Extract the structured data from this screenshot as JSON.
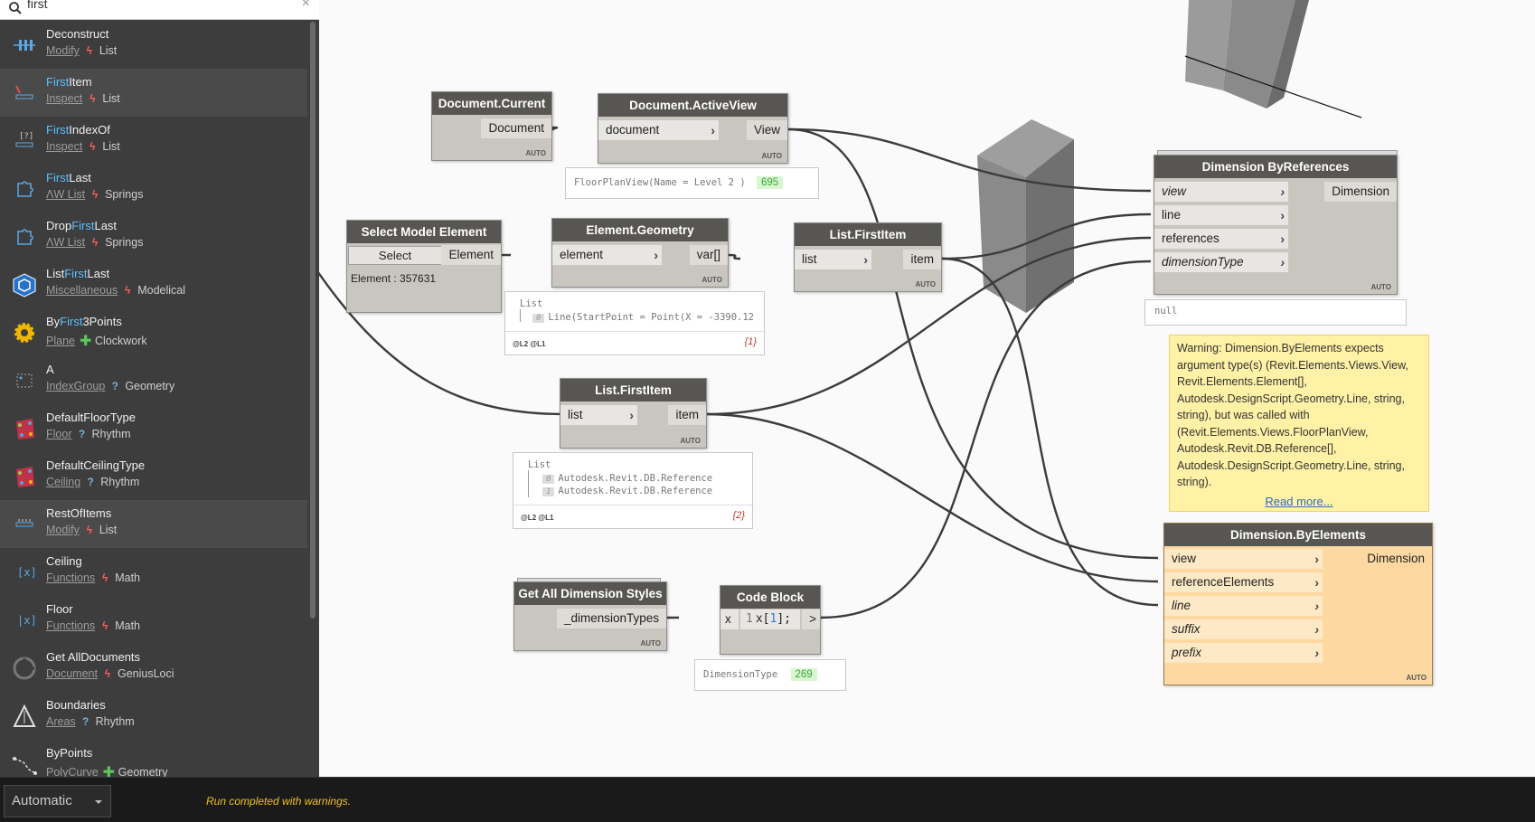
{
  "search": {
    "query": "first",
    "clear_glyph": "×"
  },
  "library": [
    {
      "pre": "",
      "match": "",
      "post": "Deconstruct",
      "category": "Modify",
      "type": "action",
      "type_glyph": "ϟ",
      "package": "List",
      "icon": "deconstruct-icon",
      "hl": false
    },
    {
      "pre": "",
      "match": "First",
      "post": "Item",
      "category": "Inspect",
      "type": "action",
      "type_glyph": "ϟ",
      "package": "List",
      "icon": "first-item-icon",
      "hl": true
    },
    {
      "pre": "",
      "match": "First",
      "post": "IndexOf",
      "category": "Inspect",
      "type": "action",
      "type_glyph": "ϟ",
      "package": "List",
      "icon": "first-index-of-icon",
      "hl": false
    },
    {
      "pre": "",
      "match": "First",
      "post": "Last",
      "category": "ΛW List",
      "type": "action",
      "type_glyph": "ϟ",
      "package": "Springs",
      "icon": "puzzle-icon",
      "hl": false
    },
    {
      "pre": "Drop",
      "match": "First",
      "post": "Last",
      "category": "ΛW List",
      "type": "action",
      "type_glyph": "ϟ",
      "package": "Springs",
      "icon": "puzzle-icon",
      "hl": false
    },
    {
      "pre": "List",
      "match": "First",
      "post": "Last",
      "category": "Miscellaneous",
      "type": "action",
      "type_glyph": "ϟ",
      "package": "Modelical",
      "icon": "cube-icon",
      "hl": false
    },
    {
      "pre": "By",
      "match": "First",
      "post": "3Points",
      "category": "Plane",
      "type": "create",
      "type_glyph": "✚",
      "package": "Clockwork",
      "icon": "gear-icon",
      "hl": false
    },
    {
      "pre": "",
      "match": "",
      "post": "A",
      "category": "IndexGroup",
      "type": "query",
      "type_glyph": "?",
      "package": "Geometry",
      "icon": "index-group-icon",
      "hl": false
    },
    {
      "pre": "",
      "match": "",
      "post": "DefaultFloorType",
      "category": "Floor",
      "type": "query",
      "type_glyph": "?",
      "package": "Rhythm",
      "icon": "rhythm-icon",
      "hl": false
    },
    {
      "pre": "",
      "match": "",
      "post": "DefaultCeilingType",
      "category": "Ceiling",
      "type": "query",
      "type_glyph": "?",
      "package": "Rhythm",
      "icon": "rhythm-icon",
      "hl": false
    },
    {
      "pre": "",
      "match": "",
      "post": "RestOfItems",
      "category": "Modify",
      "type": "action",
      "type_glyph": "ϟ",
      "package": "List",
      "icon": "rest-of-items-icon",
      "hl": true
    },
    {
      "pre": "",
      "match": "",
      "post": "Ceiling",
      "category": "Functions",
      "type": "action",
      "type_glyph": "ϟ",
      "package": "Math",
      "icon": "math-ceiling-icon",
      "hl": false
    },
    {
      "pre": "",
      "match": "",
      "post": "Floor",
      "category": "Functions",
      "type": "action",
      "type_glyph": "ϟ",
      "package": "Math",
      "icon": "math-floor-icon",
      "hl": false
    },
    {
      "pre": "",
      "match": "",
      "post": "Get AllDocuments",
      "category": "Document",
      "type": "action",
      "type_glyph": "ϟ",
      "package": "GeniusLoci",
      "icon": "genius-loci-icon",
      "hl": false
    },
    {
      "pre": "",
      "match": "",
      "post": "Boundaries",
      "category": "Areas",
      "type": "query",
      "type_glyph": "?",
      "package": "Rhythm",
      "icon": "boundaries-icon",
      "hl": false
    },
    {
      "pre": "",
      "match": "",
      "post": "ByPoints",
      "category": "PolyCurve",
      "type": "create",
      "type_glyph": "✚",
      "package": "Geometry",
      "icon": "polycurve-icon",
      "hl": false
    }
  ],
  "nodes": {
    "doc_current": {
      "title": "Document.Current",
      "out": "Document",
      "auto": "AUTO"
    },
    "doc_activeview": {
      "title": "Document.ActiveView",
      "in": "document",
      "out": "View",
      "auto": "AUTO"
    },
    "select_element": {
      "title": "Select Model Element",
      "button": "Select",
      "out": "Element",
      "info": "Element : 357631"
    },
    "element_geometry": {
      "title": "Element.Geometry",
      "in": "element",
      "out": "var[]",
      "auto": "AUTO"
    },
    "firstitem_1": {
      "title": "List.FirstItem",
      "in": "list",
      "out": "item",
      "auto": "AUTO"
    },
    "firstitem_2": {
      "title": "List.FirstItem",
      "in": "list",
      "out": "item",
      "auto": "AUTO"
    },
    "dim_byrefs": {
      "title": "Dimension ByReferences",
      "in": [
        "view",
        "line",
        "references",
        "dimensionType"
      ],
      "out": "Dimension",
      "auto": "AUTO"
    },
    "dim_byelems": {
      "title": "Dimension.ByElements",
      "in": [
        "view",
        "referenceElements",
        "line",
        "suffix",
        "prefix"
      ],
      "out": "Dimension",
      "auto": "AUTO"
    },
    "dim_styles": {
      "title": "Get All Dimension Styles",
      "out": "_dimensionTypes",
      "auto": "AUTO"
    },
    "code_block": {
      "title": "Code Block",
      "in": "x",
      "line": "1",
      "code_a": "x[",
      "code_num": "1",
      "code_b": "];",
      "out": ">"
    }
  },
  "previews": {
    "activeview": {
      "text": "FloorPlanView(Name = Level 2 )",
      "badge": "695"
    },
    "geometry": {
      "list": "List",
      "idx": "0",
      "item": "Line(StartPoint = Point(X = -3390.12",
      "levels": "@L2 @L1",
      "count": "{1}"
    },
    "firstitem_2": {
      "list": "List",
      "idx0": "0",
      "item0": "Autodesk.Revit.DB.Reference",
      "idx1": "1",
      "item1": "Autodesk.Revit.DB.Reference",
      "levels": "@L2 @L1",
      "count": "{2}"
    },
    "dim_byrefs": {
      "text": "null"
    },
    "code_block": {
      "text": "DimensionType",
      "badge": "269"
    }
  },
  "warning": {
    "text": "Warning: Dimension.ByElements expects argument type(s) (Revit.Elements.Views.View, Revit.Elements.Element[], Autodesk.DesignScript.Geometry.Line, string, string), but was called with (Revit.Elements.Views.FloorPlanView, Autodesk.Revit.DB.Reference[], Autodesk.DesignScript.Geometry.Line, string, string).",
    "link": "Read more..."
  },
  "bottom": {
    "run_mode": "Automatic",
    "status": "Run completed with warnings."
  },
  "colors": {
    "sidebar_bg": "#3d3d3d",
    "match_highlight": "#59c0ff",
    "node_header": "#585652",
    "node_body": "#c9c6c0",
    "warning_node": "#fdd8a1",
    "warning_bubble": "#fff1a6",
    "status_text": "#f2c025",
    "wire": "#3b3b3b"
  }
}
